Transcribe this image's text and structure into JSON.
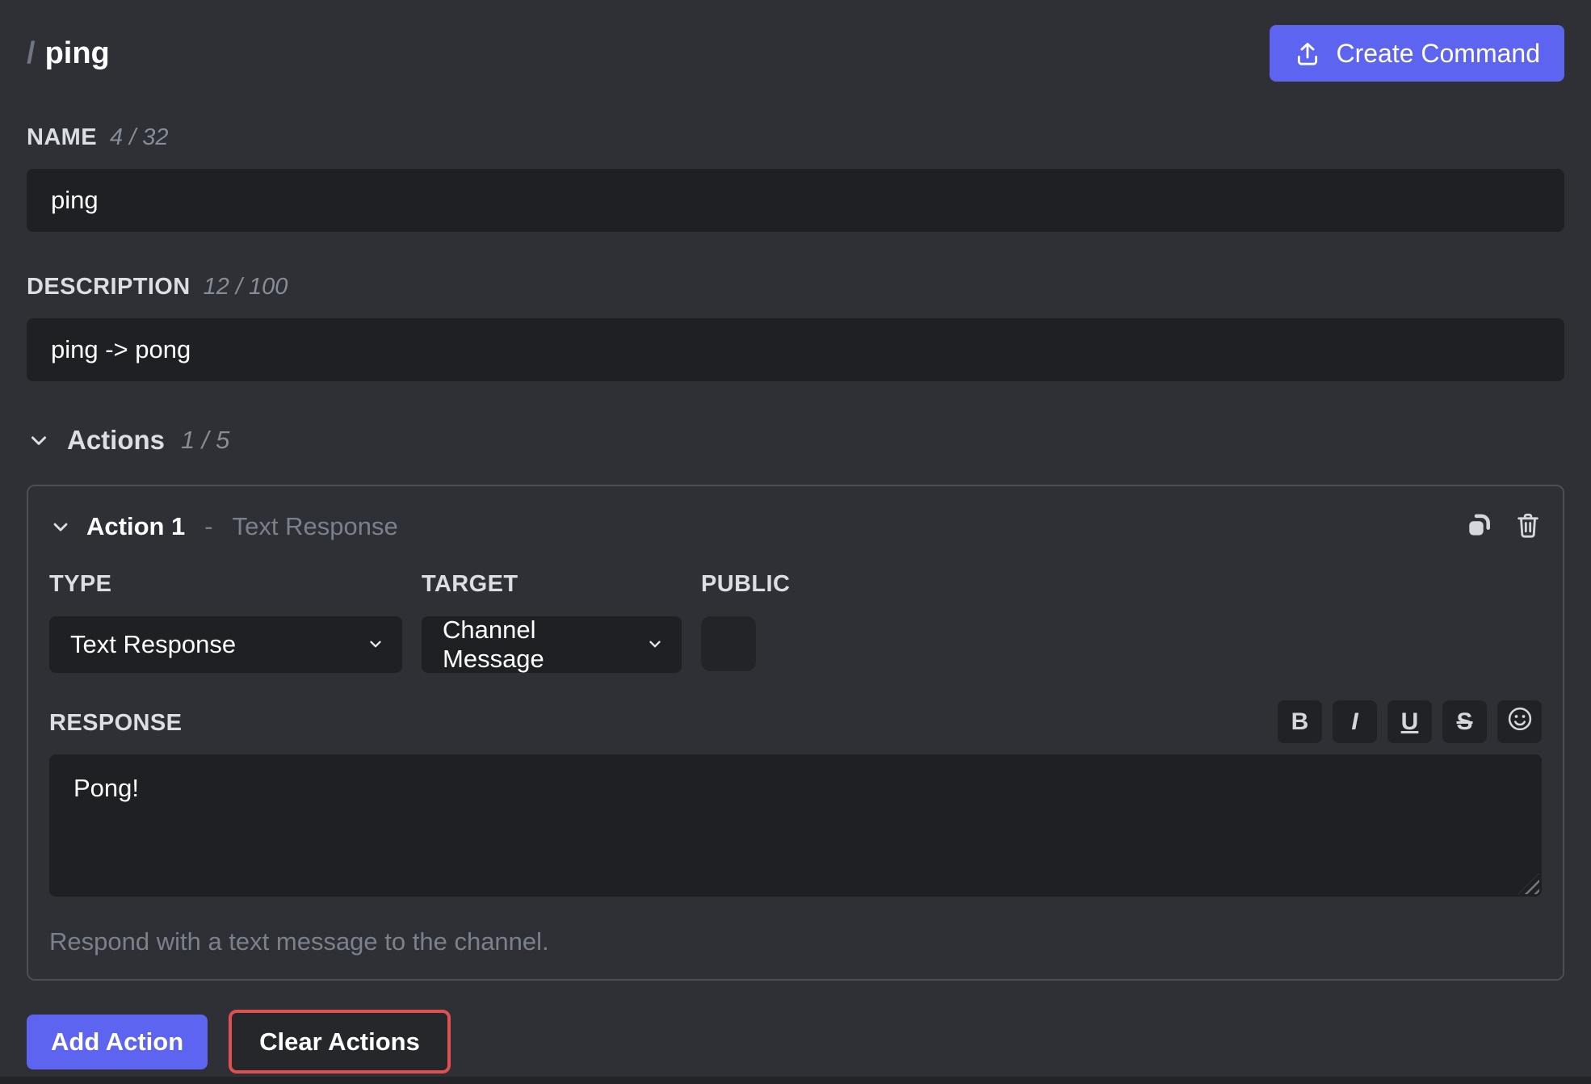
{
  "header": {
    "title_prefix": "/",
    "title": "ping",
    "create_button_label": "Create Command"
  },
  "name_field": {
    "label": "NAME",
    "counter": "4 / 32",
    "value": "ping"
  },
  "description_field": {
    "label": "DESCRIPTION",
    "counter": "12 / 100",
    "value": "ping -> pong"
  },
  "actions_section": {
    "label": "Actions",
    "counter": "1 / 5",
    "add_button_label": "Add Action",
    "clear_button_label": "Clear Actions"
  },
  "action": {
    "title": "Action 1",
    "separator": "-",
    "subtitle": "Text Response",
    "type_field": {
      "label": "TYPE",
      "value": "Text Response"
    },
    "target_field": {
      "label": "TARGET",
      "value": "Channel Message"
    },
    "public_field": {
      "label": "PUBLIC",
      "checked": false
    },
    "response_field": {
      "label": "RESPONSE",
      "value": "Pong!"
    },
    "toolbar": {
      "bold": "B",
      "italic": "I",
      "underline": "U",
      "strikethrough": "S",
      "emoji_icon": "smiley-face"
    },
    "helper_text": "Respond with a text message to the channel."
  },
  "colors": {
    "accent": "#5c64f0",
    "danger": "#e0504e",
    "background": "#2e3035",
    "input_background": "#1f2024",
    "card_border": "#4b4e56"
  }
}
